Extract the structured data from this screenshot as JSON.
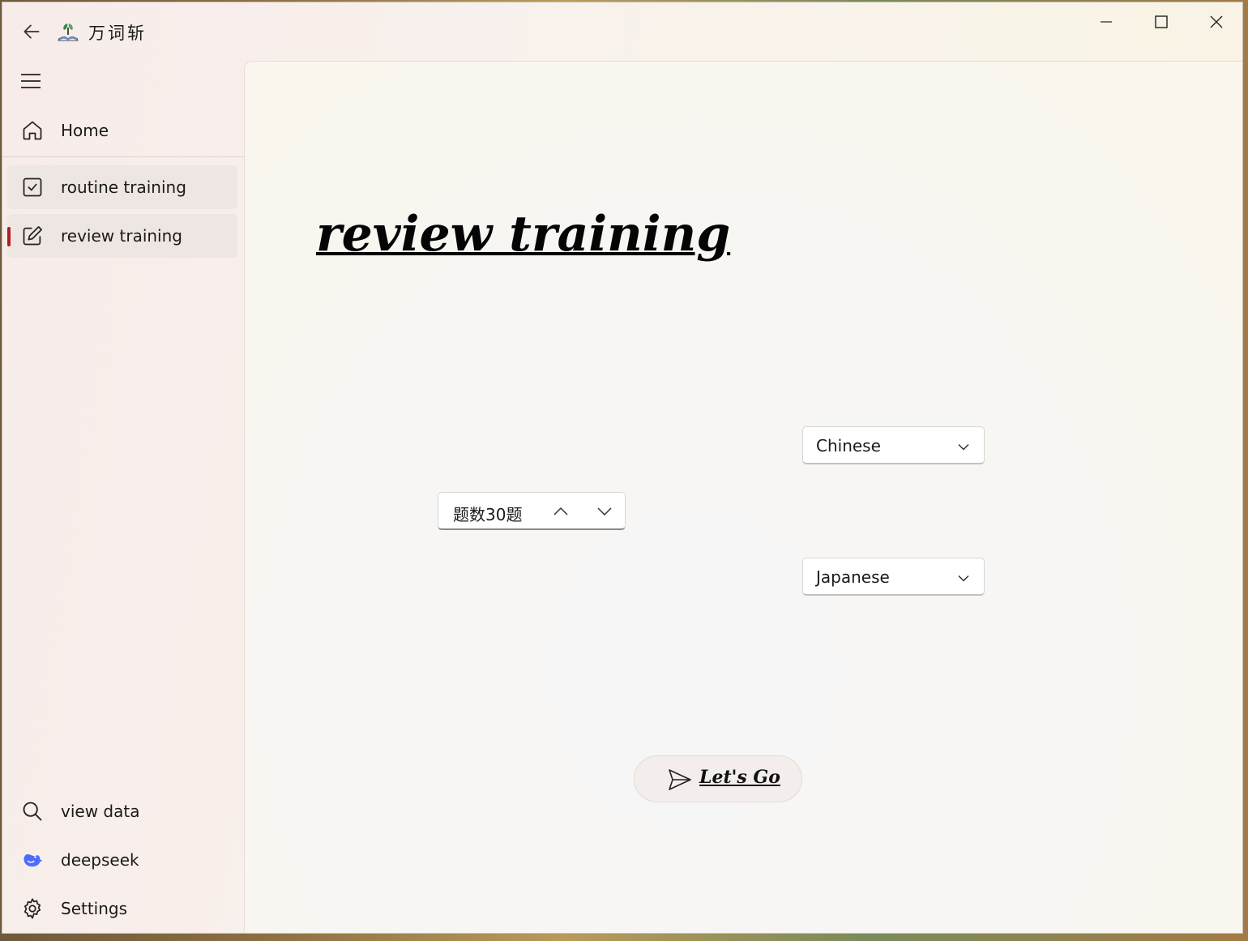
{
  "titlebar": {
    "app_title": "万词斩",
    "icons": {
      "back": "arrow-left-icon",
      "logo": "app-logo-icon",
      "minimize": "minimize-icon",
      "maximize": "maximize-icon",
      "close": "close-icon"
    }
  },
  "sidebar": {
    "menu_icon": "hamburger-menu-icon",
    "items": [
      {
        "label": "Home",
        "icon": "home-icon"
      },
      {
        "label": "routine training",
        "icon": "checkbox-icon"
      },
      {
        "label": "review training",
        "icon": "edit-icon",
        "selected": true
      },
      {
        "label": "view data",
        "icon": "search-icon"
      },
      {
        "label": "deepseek",
        "icon": "deepseek-whale-icon"
      },
      {
        "label": "Settings",
        "icon": "gear-icon"
      }
    ],
    "accent_color": "#b01e22"
  },
  "main": {
    "title": "review training",
    "question_count": {
      "value": "题数30题"
    },
    "source_language": {
      "selected": "Chinese"
    },
    "target_language": {
      "selected": "Japanese"
    },
    "start_button": {
      "label": "Let's Go",
      "icon": "send-icon"
    }
  }
}
